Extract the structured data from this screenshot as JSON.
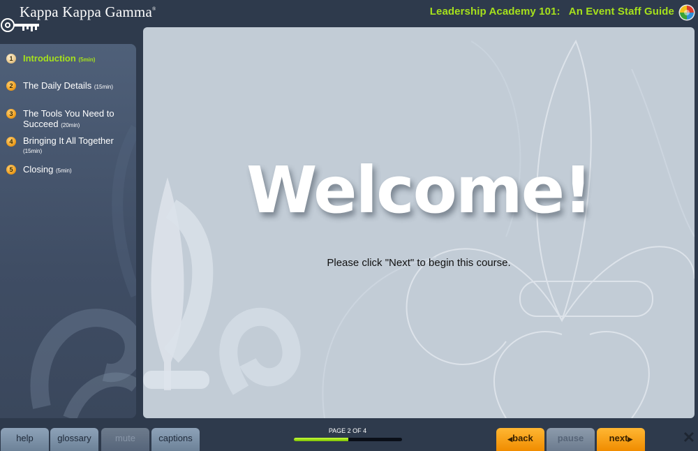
{
  "header": {
    "brand": "Kappa Kappa Gamma",
    "brand_mark": "®",
    "course_title": "Leadership Academy 101:   An Event Staff Guide"
  },
  "sidebar": {
    "items": [
      {
        "num": "1",
        "label": "Introduction",
        "duration": "(5min)",
        "active": true
      },
      {
        "num": "2",
        "label": "The Daily Details",
        "duration": "(15min)",
        "active": false
      },
      {
        "num": "3",
        "label": "The Tools You Need to Succeed",
        "duration": "(20min)",
        "active": false
      },
      {
        "num": "4",
        "label": "Bringing It All Together",
        "duration": "(15min)",
        "active": false
      },
      {
        "num": "5",
        "label": "Closing",
        "duration": "(5min)",
        "active": false
      }
    ]
  },
  "main": {
    "heading": "Welcome!",
    "instruction": "Please click \"Next\" to begin this course."
  },
  "footer": {
    "help_label": "help",
    "glossary_label": "glossary",
    "mute_label": "mute",
    "captions_label": "captions",
    "page_label": "PAGE 2 OF 4",
    "progress_fraction": 0.5,
    "back_label": "back",
    "pause_label": "pause",
    "next_label": "next",
    "close_icon": "close-icon"
  },
  "colors": {
    "accent_green": "#a6e11c",
    "button_orange": "#f5a000",
    "content_bg": "#c2ccd6",
    "page_bg": "#2e3a4c"
  }
}
